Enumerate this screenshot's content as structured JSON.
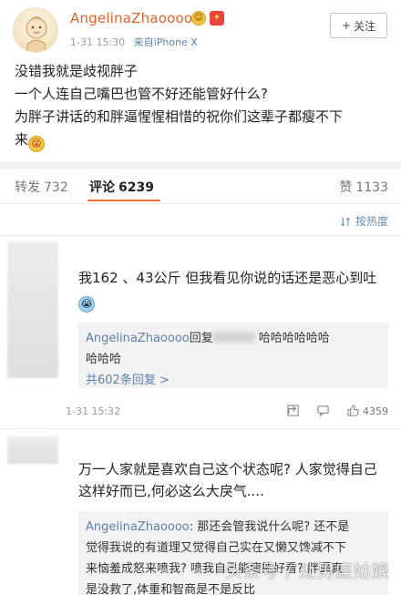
{
  "post": {
    "username": "AngelinaZhaoooo",
    "time": "1-31 15:30",
    "source_prefix": "来自",
    "source": "iPhone X",
    "follow_label": "关注",
    "lines": [
      "没错我就是歧视胖子",
      "一个人连自己嘴巴也管不好还能管好什么?",
      "为胖子讲话的和胖逼惺惺相惜的祝你们这辈子都瘦不下",
      "来"
    ]
  },
  "tabs": [
    {
      "label": "转发",
      "count": "732"
    },
    {
      "label": "评论",
      "count": "6239"
    },
    {
      "label": "赞",
      "count": "1133"
    }
  ],
  "sort_label": "按热度",
  "comments": [
    {
      "text_line1": "我162 、43公斤 但我看见你说的话还是恶心到吐",
      "reply": {
        "author": "AngelinaZhaoooo",
        "action": "回复",
        "text_a": "哈哈哈哈哈哈",
        "text_b": "哈哈哈",
        "more": "共602条回复 >"
      },
      "time": "1-31 15:32",
      "likes": "4359"
    },
    {
      "text_line1": "万一人家就是喜欢自己这个状态呢? 人家觉得自己",
      "text_line2": "这样好而已,何必这么大戾气....",
      "reply": {
        "author": "AngelinaZhaoooo",
        "line1": ": 那还会管我说什么呢? 还不是",
        "line2": "觉得我说的有道理又觉得自己实在又懒又馋减不下",
        "line3": "来恼羞成怒来喷我? 喷我自己能瘦能好看? 胖逼真",
        "line4": "是没救了,体重和智商是不是反比"
      }
    }
  ],
  "watermark": "头条号 / 处男座姑娘",
  "colors": {
    "username": "#e0632c",
    "link": "#5d7fae",
    "accent_underline": "#e8743b"
  }
}
